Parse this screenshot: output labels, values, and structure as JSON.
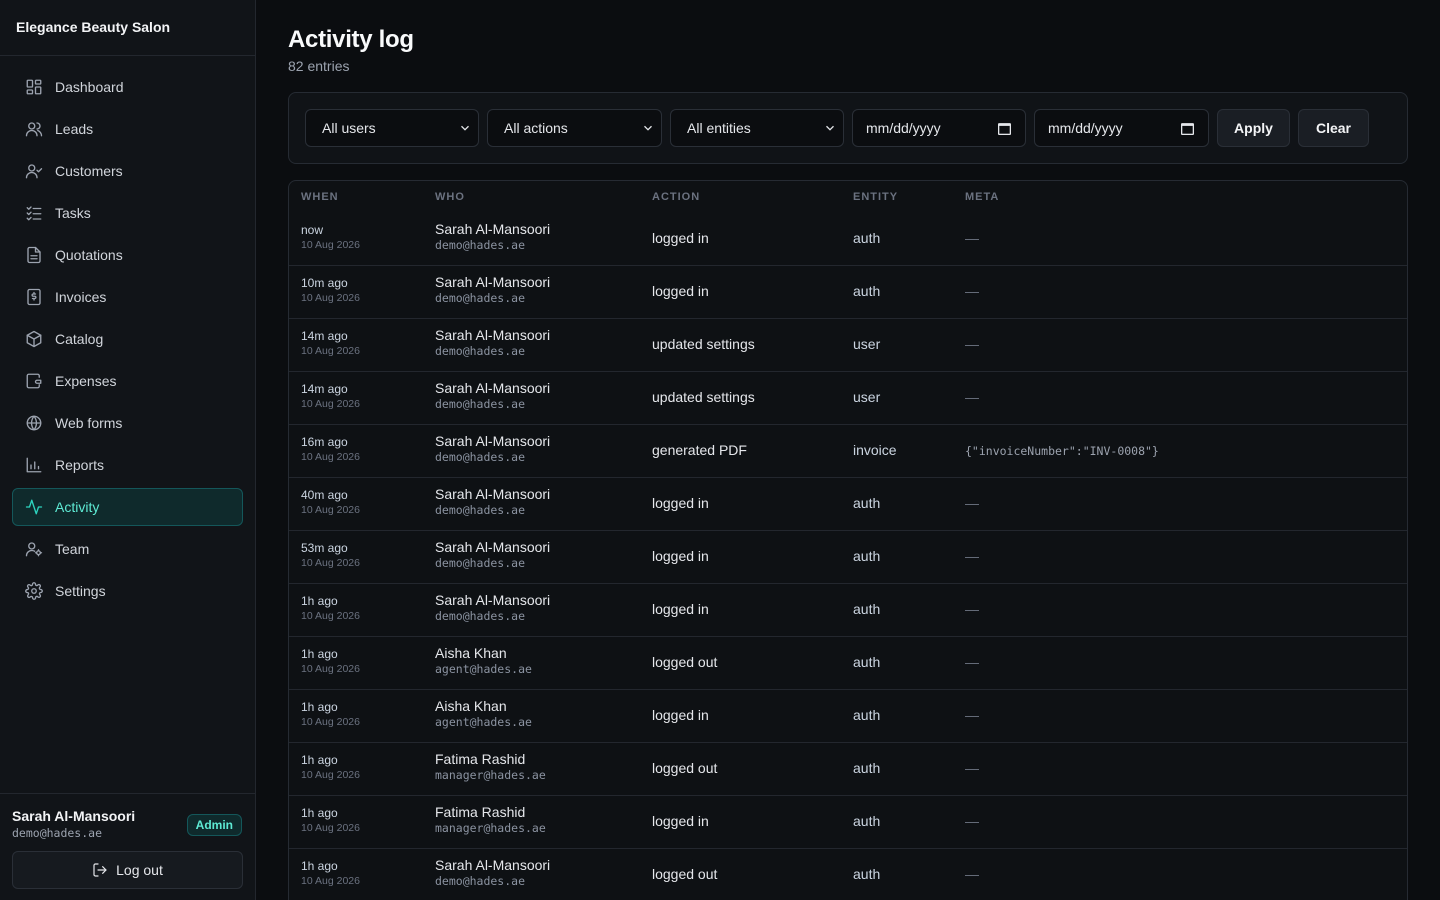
{
  "app": {
    "brand": "Elegance Beauty Salon"
  },
  "sidebar": {
    "items": [
      {
        "label": "Dashboard",
        "icon": "dashboard-icon",
        "active": false
      },
      {
        "label": "Leads",
        "icon": "leads-icon",
        "active": false
      },
      {
        "label": "Customers",
        "icon": "customers-icon",
        "active": false
      },
      {
        "label": "Tasks",
        "icon": "tasks-icon",
        "active": false
      },
      {
        "label": "Quotations",
        "icon": "quotations-icon",
        "active": false
      },
      {
        "label": "Invoices",
        "icon": "invoices-icon",
        "active": false
      },
      {
        "label": "Catalog",
        "icon": "catalog-icon",
        "active": false
      },
      {
        "label": "Expenses",
        "icon": "expenses-icon",
        "active": false
      },
      {
        "label": "Web forms",
        "icon": "globe-icon",
        "active": false
      },
      {
        "label": "Reports",
        "icon": "reports-icon",
        "active": false
      },
      {
        "label": "Activity",
        "icon": "activity-icon",
        "active": true
      },
      {
        "label": "Team",
        "icon": "team-icon",
        "active": false
      },
      {
        "label": "Settings",
        "icon": "gear-icon",
        "active": false
      }
    ],
    "user": {
      "name": "Sarah Al-Mansoori",
      "email": "demo@hades.ae",
      "role": "Admin"
    },
    "logout_label": "Log out"
  },
  "header": {
    "title": "Activity log",
    "subtitle": "82 entries"
  },
  "filters": {
    "users": "All users",
    "actions": "All actions",
    "entities": "All entities",
    "date_from": "mm/dd/yyyy",
    "date_to": "mm/dd/yyyy",
    "apply_label": "Apply",
    "clear_label": "Clear"
  },
  "table": {
    "columns": [
      "WHEN",
      "WHO",
      "ACTION",
      "ENTITY",
      "META"
    ],
    "rows": [
      {
        "when": "now",
        "date": "10 Aug 2026",
        "name": "Sarah Al-Mansoori",
        "email": "demo@hades.ae",
        "action": "logged in",
        "entity": "auth",
        "meta": "—"
      },
      {
        "when": "10m ago",
        "date": "10 Aug 2026",
        "name": "Sarah Al-Mansoori",
        "email": "demo@hades.ae",
        "action": "logged in",
        "entity": "auth",
        "meta": "—"
      },
      {
        "when": "14m ago",
        "date": "10 Aug 2026",
        "name": "Sarah Al-Mansoori",
        "email": "demo@hades.ae",
        "action": "updated settings",
        "entity": "user",
        "meta": "—"
      },
      {
        "when": "14m ago",
        "date": "10 Aug 2026",
        "name": "Sarah Al-Mansoori",
        "email": "demo@hades.ae",
        "action": "updated settings",
        "entity": "user",
        "meta": "—"
      },
      {
        "when": "16m ago",
        "date": "10 Aug 2026",
        "name": "Sarah Al-Mansoori",
        "email": "demo@hades.ae",
        "action": "generated PDF",
        "entity": "invoice",
        "meta": "{\"invoiceNumber\":\"INV-0008\"}"
      },
      {
        "when": "40m ago",
        "date": "10 Aug 2026",
        "name": "Sarah Al-Mansoori",
        "email": "demo@hades.ae",
        "action": "logged in",
        "entity": "auth",
        "meta": "—"
      },
      {
        "when": "53m ago",
        "date": "10 Aug 2026",
        "name": "Sarah Al-Mansoori",
        "email": "demo@hades.ae",
        "action": "logged in",
        "entity": "auth",
        "meta": "—"
      },
      {
        "when": "1h ago",
        "date": "10 Aug 2026",
        "name": "Sarah Al-Mansoori",
        "email": "demo@hades.ae",
        "action": "logged in",
        "entity": "auth",
        "meta": "—"
      },
      {
        "when": "1h ago",
        "date": "10 Aug 2026",
        "name": "Aisha Khan",
        "email": "agent@hades.ae",
        "action": "logged out",
        "entity": "auth",
        "meta": "—"
      },
      {
        "when": "1h ago",
        "date": "10 Aug 2026",
        "name": "Aisha Khan",
        "email": "agent@hades.ae",
        "action": "logged in",
        "entity": "auth",
        "meta": "—"
      },
      {
        "when": "1h ago",
        "date": "10 Aug 2026",
        "name": "Fatima Rashid",
        "email": "manager@hades.ae",
        "action": "logged out",
        "entity": "auth",
        "meta": "—"
      },
      {
        "when": "1h ago",
        "date": "10 Aug 2026",
        "name": "Fatima Rashid",
        "email": "manager@hades.ae",
        "action": "logged in",
        "entity": "auth",
        "meta": "—"
      },
      {
        "when": "1h ago",
        "date": "10 Aug 2026",
        "name": "Sarah Al-Mansoori",
        "email": "demo@hades.ae",
        "action": "logged out",
        "entity": "auth",
        "meta": "—"
      }
    ]
  },
  "colors": {
    "accent": "#2dd4bf",
    "background": "#0b0d10",
    "sidebar": "#111418"
  }
}
